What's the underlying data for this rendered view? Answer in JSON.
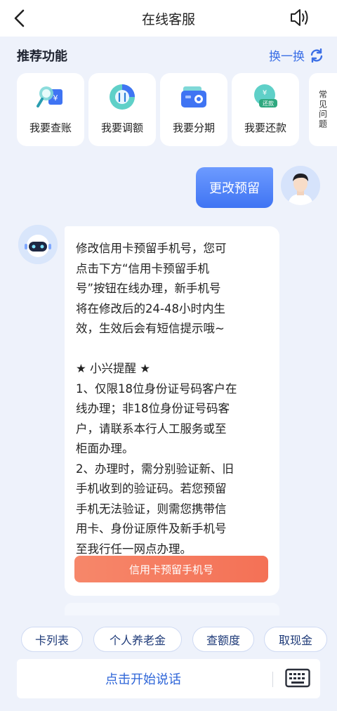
{
  "header": {
    "title": "在线客服",
    "back_icon": "back-arrow-icon",
    "speaker_icon": "speaker-icon"
  },
  "recommend": {
    "title": "推荐功能",
    "refresh_label": "换一换",
    "items": [
      {
        "label": "我要查账",
        "icon": "search-bill-icon"
      },
      {
        "label": "我要调额",
        "icon": "adjust-limit-icon"
      },
      {
        "label": "我要分期",
        "icon": "installment-wallet-icon"
      },
      {
        "label": "我要还款",
        "icon": "repay-coin-icon"
      }
    ],
    "faq_label": "常见问题"
  },
  "chat": {
    "user_message": "更改预留",
    "bot_message": "修改信用卡预留手机号，您可\n点击下方“信用卡预留手机\n号”按钮在线办理，新手机号\n将在修改后的24-48小时内生\n效，生效后会有短信提示哦~\n\n★ 小兴提醒 ★\n1、仅限18位身份证号码客户在\n线办理；非18位身份证号码客\n户，请联系本行人工服务或至\n柜面办理。\n2、办理时，需分别验证新、旧\n手机收到的验证码。若您预留\n手机无法验证，则需您携带信\n用卡、身份证原件及新手机号\n至我行任一网点办理。",
    "cta_label": "信用卡预留手机号"
  },
  "quick_chips": [
    "卡列表",
    "个人养老金",
    "查额度",
    "取现金"
  ],
  "input": {
    "label": "点击开始说话",
    "keyboard_icon": "keyboard-icon"
  },
  "colors": {
    "accent": "#3b6fe6",
    "cta": "#f47156",
    "background": "#eef2fb"
  }
}
